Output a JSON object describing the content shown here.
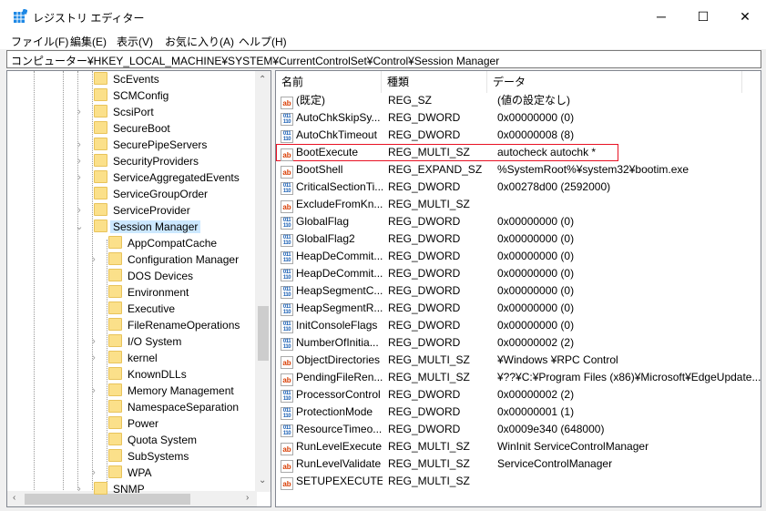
{
  "window": {
    "title": "レジストリ エディター",
    "minimize": "─",
    "maximize": "☐",
    "close": "✕",
    "icon": "registry-editor-icon"
  },
  "menu": [
    "ファイル(F)",
    "編集(E)",
    "表示(V)",
    "お気に入り(A)",
    "ヘルプ(H)"
  ],
  "address": "コンピューター¥HKEY_LOCAL_MACHINE¥SYSTEM¥CurrentControlSet¥Control¥Session Manager",
  "tree": [
    {
      "label": "ScEvents",
      "level": 0,
      "exp": ""
    },
    {
      "label": "SCMConfig",
      "level": 0,
      "exp": ""
    },
    {
      "label": "ScsiPort",
      "level": 0,
      "exp": "›"
    },
    {
      "label": "SecureBoot",
      "level": 0,
      "exp": ""
    },
    {
      "label": "SecurePipeServers",
      "level": 0,
      "exp": "›"
    },
    {
      "label": "SecurityProviders",
      "level": 0,
      "exp": "›"
    },
    {
      "label": "ServiceAggregatedEvents",
      "level": 0,
      "exp": "›"
    },
    {
      "label": "ServiceGroupOrder",
      "level": 0,
      "exp": ""
    },
    {
      "label": "ServiceProvider",
      "level": 0,
      "exp": "›"
    },
    {
      "label": "Session Manager",
      "level": 0,
      "exp": "⌄",
      "selected": true
    },
    {
      "label": "AppCompatCache",
      "level": 1,
      "exp": ""
    },
    {
      "label": "Configuration Manager",
      "level": 1,
      "exp": "›"
    },
    {
      "label": "DOS Devices",
      "level": 1,
      "exp": ""
    },
    {
      "label": "Environment",
      "level": 1,
      "exp": ""
    },
    {
      "label": "Executive",
      "level": 1,
      "exp": ""
    },
    {
      "label": "FileRenameOperations",
      "level": 1,
      "exp": ""
    },
    {
      "label": "I/O System",
      "level": 1,
      "exp": "›"
    },
    {
      "label": "kernel",
      "level": 1,
      "exp": "›"
    },
    {
      "label": "KnownDLLs",
      "level": 1,
      "exp": ""
    },
    {
      "label": "Memory Management",
      "level": 1,
      "exp": "›"
    },
    {
      "label": "NamespaceSeparation",
      "level": 1,
      "exp": ""
    },
    {
      "label": "Power",
      "level": 1,
      "exp": ""
    },
    {
      "label": "Quota System",
      "level": 1,
      "exp": ""
    },
    {
      "label": "SubSystems",
      "level": 1,
      "exp": ""
    },
    {
      "label": "WPA",
      "level": 1,
      "exp": "›"
    },
    {
      "label": "SNMP",
      "level": 0,
      "exp": "›"
    }
  ],
  "columns": [
    "名前",
    "種類",
    "データ"
  ],
  "values": [
    {
      "name": "(既定)",
      "type": "REG_SZ",
      "data": "(値の設定なし)",
      "icon": "ab"
    },
    {
      "name": "AutoChkSkipSy...",
      "type": "REG_DWORD",
      "data": "0x00000000 (0)",
      "icon": "bin"
    },
    {
      "name": "AutoChkTimeout",
      "type": "REG_DWORD",
      "data": "0x00000008 (8)",
      "icon": "bin"
    },
    {
      "name": "BootExecute",
      "type": "REG_MULTI_SZ",
      "data": "autocheck autochk *",
      "icon": "ab",
      "highlighted": true
    },
    {
      "name": "BootShell",
      "type": "REG_EXPAND_SZ",
      "data": "%SystemRoot%¥system32¥bootim.exe",
      "icon": "ab"
    },
    {
      "name": "CriticalSectionTi...",
      "type": "REG_DWORD",
      "data": "0x00278d00 (2592000)",
      "icon": "bin"
    },
    {
      "name": "ExcludeFromKn...",
      "type": "REG_MULTI_SZ",
      "data": "",
      "icon": "ab"
    },
    {
      "name": "GlobalFlag",
      "type": "REG_DWORD",
      "data": "0x00000000 (0)",
      "icon": "bin"
    },
    {
      "name": "GlobalFlag2",
      "type": "REG_DWORD",
      "data": "0x00000000 (0)",
      "icon": "bin"
    },
    {
      "name": "HeapDeCommit...",
      "type": "REG_DWORD",
      "data": "0x00000000 (0)",
      "icon": "bin"
    },
    {
      "name": "HeapDeCommit...",
      "type": "REG_DWORD",
      "data": "0x00000000 (0)",
      "icon": "bin"
    },
    {
      "name": "HeapSegmentC...",
      "type": "REG_DWORD",
      "data": "0x00000000 (0)",
      "icon": "bin"
    },
    {
      "name": "HeapSegmentR...",
      "type": "REG_DWORD",
      "data": "0x00000000 (0)",
      "icon": "bin"
    },
    {
      "name": "InitConsoleFlags",
      "type": "REG_DWORD",
      "data": "0x00000000 (0)",
      "icon": "bin"
    },
    {
      "name": "NumberOfInitia...",
      "type": "REG_DWORD",
      "data": "0x00000002 (2)",
      "icon": "bin"
    },
    {
      "name": "ObjectDirectories",
      "type": "REG_MULTI_SZ",
      "data": "¥Windows ¥RPC Control",
      "icon": "ab"
    },
    {
      "name": "PendingFileRen...",
      "type": "REG_MULTI_SZ",
      "data": "¥??¥C:¥Program Files (x86)¥Microsoft¥EdgeUpdate...",
      "icon": "ab"
    },
    {
      "name": "ProcessorControl",
      "type": "REG_DWORD",
      "data": "0x00000002 (2)",
      "icon": "bin"
    },
    {
      "name": "ProtectionMode",
      "type": "REG_DWORD",
      "data": "0x00000001 (1)",
      "icon": "bin"
    },
    {
      "name": "ResourceTimeo...",
      "type": "REG_DWORD",
      "data": "0x0009e340 (648000)",
      "icon": "bin"
    },
    {
      "name": "RunLevelExecute",
      "type": "REG_MULTI_SZ",
      "data": "WinInit ServiceControlManager",
      "icon": "ab"
    },
    {
      "name": "RunLevelValidate",
      "type": "REG_MULTI_SZ",
      "data": "ServiceControlManager",
      "icon": "ab"
    },
    {
      "name": "SETUPEXECUTE",
      "type": "REG_MULTI_SZ",
      "data": "",
      "icon": "ab"
    }
  ],
  "colors": {
    "highlight_border": "#e81123",
    "selection": "#cce8ff"
  }
}
